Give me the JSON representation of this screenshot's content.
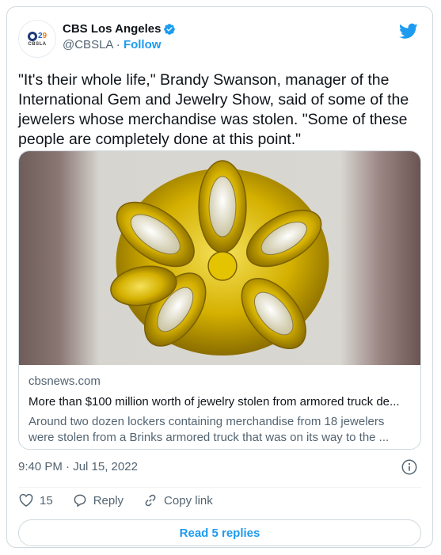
{
  "account": {
    "name": "CBS Los Angeles",
    "handle": "@CBSLA",
    "separator": "·",
    "follow_label": "Follow",
    "avatar_number": [
      "2",
      "9"
    ],
    "avatar_caption": "CBSLA"
  },
  "tweet": {
    "text": "\"It's their whole life,\" Brandy Swanson, manager of the International Gem and Jewelry Show, said of some of the jewelers whose merchandise was stolen. \"Some of these people are completely done at this point.\""
  },
  "link_card": {
    "domain": "cbsnews.com",
    "title": "More than $100 million worth of jewelry stolen from armored truck de...",
    "description": "Around two dozen lockers containing merchandise from 18 jewelers were stolen from a Brinks armored truck that was on its way to the ..."
  },
  "meta": {
    "timestamp": "9:40 PM · Jul 15, 2022"
  },
  "actions": {
    "like_count": "15",
    "reply_label": "Reply",
    "copy_link_label": "Copy link"
  },
  "replies_button": {
    "label": "Read 5 replies"
  },
  "colors": {
    "twitter_blue": "#1d9bf0",
    "secondary_text": "#536471",
    "gold": "#d4b000"
  },
  "icons": [
    "cbs-logo-icon",
    "verified-badge-icon",
    "twitter-bird-icon",
    "info-icon",
    "heart-icon",
    "reply-icon",
    "link-icon"
  ]
}
